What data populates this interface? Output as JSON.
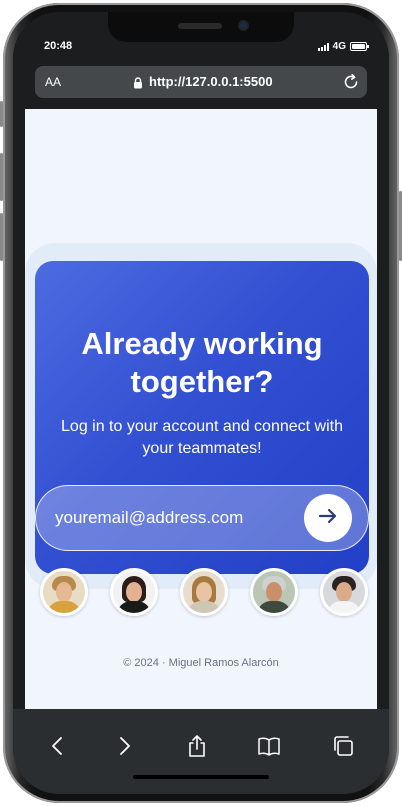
{
  "status_bar": {
    "time": "20:48",
    "network": "4G"
  },
  "browser": {
    "text_size_label": "AA",
    "url": "http://127.0.0.1:5500"
  },
  "hero": {
    "headline": "Already working together?",
    "subheadline": "Log in to your account and connect with your teammates!"
  },
  "login": {
    "email_placeholder": "youremail@address.com"
  },
  "avatars": [
    {
      "name": "avatar-1"
    },
    {
      "name": "avatar-2"
    },
    {
      "name": "avatar-3"
    },
    {
      "name": "avatar-4"
    },
    {
      "name": "avatar-5"
    }
  ],
  "footer": {
    "copyright": "© 2024 · Miguel Ramos Alarcón"
  },
  "toolbar": {
    "icons": [
      "back-icon",
      "forward-icon",
      "share-icon",
      "bookmarks-icon",
      "tabs-icon"
    ]
  },
  "colors": {
    "card_start": "#4d6be0",
    "card_end": "#2240c6",
    "page_background": "#f1f6fe",
    "arrow": "#2c3e6e"
  }
}
